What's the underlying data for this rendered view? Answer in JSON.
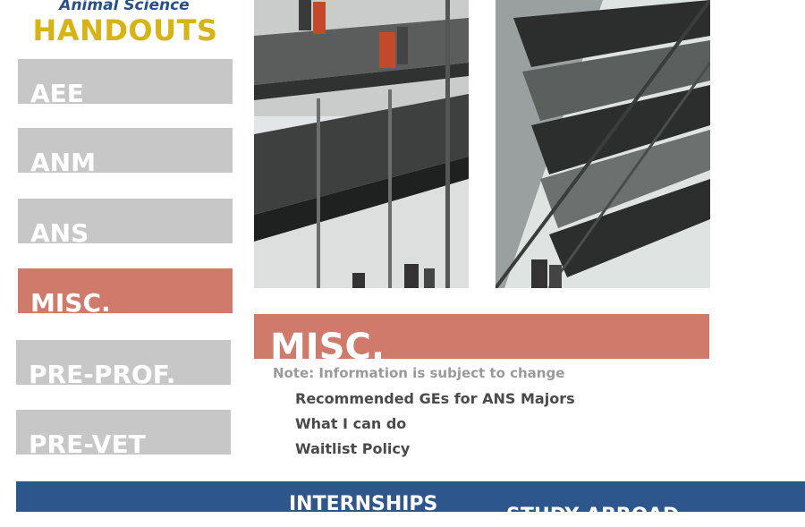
{
  "logo": {
    "top": "Animal Science",
    "main": "HANDOUTS"
  },
  "nav": {
    "items": [
      {
        "label": "AEE"
      },
      {
        "label": "ANM"
      },
      {
        "label": "ANS"
      },
      {
        "label": "MISC.",
        "active": true
      },
      {
        "label": "PRE-PROF."
      },
      {
        "label": "PRE-VET"
      }
    ]
  },
  "section": {
    "title": "MISC.",
    "note": "Note: Information is subject to change",
    "links": [
      {
        "label": "Recommended GEs for ANS Majors"
      },
      {
        "label": "What I can do"
      },
      {
        "label": "Waitlist Policy"
      }
    ]
  },
  "footer": {
    "items": [
      {
        "label": "INTERNSHIPS"
      },
      {
        "label": "STUDY ABROAD"
      }
    ]
  },
  "colors": {
    "nav_gray": "#c7c7c7",
    "accent_salmon": "#d07a6c",
    "logo_gold": "#d7b316",
    "logo_blue": "#2a4e86",
    "footer_blue": "#2c568c"
  }
}
